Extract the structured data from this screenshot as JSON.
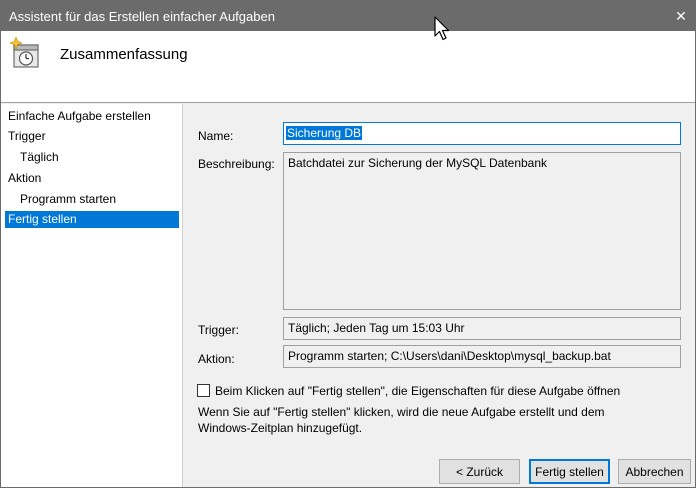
{
  "window": {
    "title": "Assistent für das Erstellen einfacher Aufgaben",
    "close_glyph": "✕"
  },
  "header": {
    "title": "Zusammenfassung",
    "icon": "task-scheduler-icon"
  },
  "sidebar": {
    "items": [
      {
        "label": "Einfache Aufgabe erstellen"
      },
      {
        "label": "Trigger"
      },
      {
        "label": "Täglich"
      },
      {
        "label": "Aktion"
      },
      {
        "label": "Programm starten"
      },
      {
        "label": "Fertig stellen"
      }
    ],
    "active_index": 5
  },
  "form": {
    "name_label": "Name:",
    "name_value": "Sicherung DB",
    "description_label": "Beschreibung:",
    "description_value": "Batchdatei zur Sicherung der MySQL Datenbank",
    "trigger_label": "Trigger:",
    "trigger_value": "Täglich; Jeden Tag um 15:03 Uhr",
    "action_label": "Aktion:",
    "action_value": "Programm starten; C:\\Users\\dani\\Desktop\\mysql_backup.bat"
  },
  "options": {
    "open_properties_label": "Beim Klicken auf \"Fertig stellen\", die Eigenschaften für diese Aufgabe öffnen",
    "open_properties_checked": false,
    "info_line1": "Wenn Sie auf \"Fertig stellen\" klicken, wird die neue Aufgabe erstellt und dem",
    "info_line2": "Windows-Zeitplan hinzugefügt."
  },
  "buttons": {
    "back": "< Zurück",
    "finish": "Fertig stellen",
    "cancel": "Abbrechen"
  },
  "colors": {
    "accent": "#0078d7",
    "titlebar": "#6b6b6b"
  }
}
